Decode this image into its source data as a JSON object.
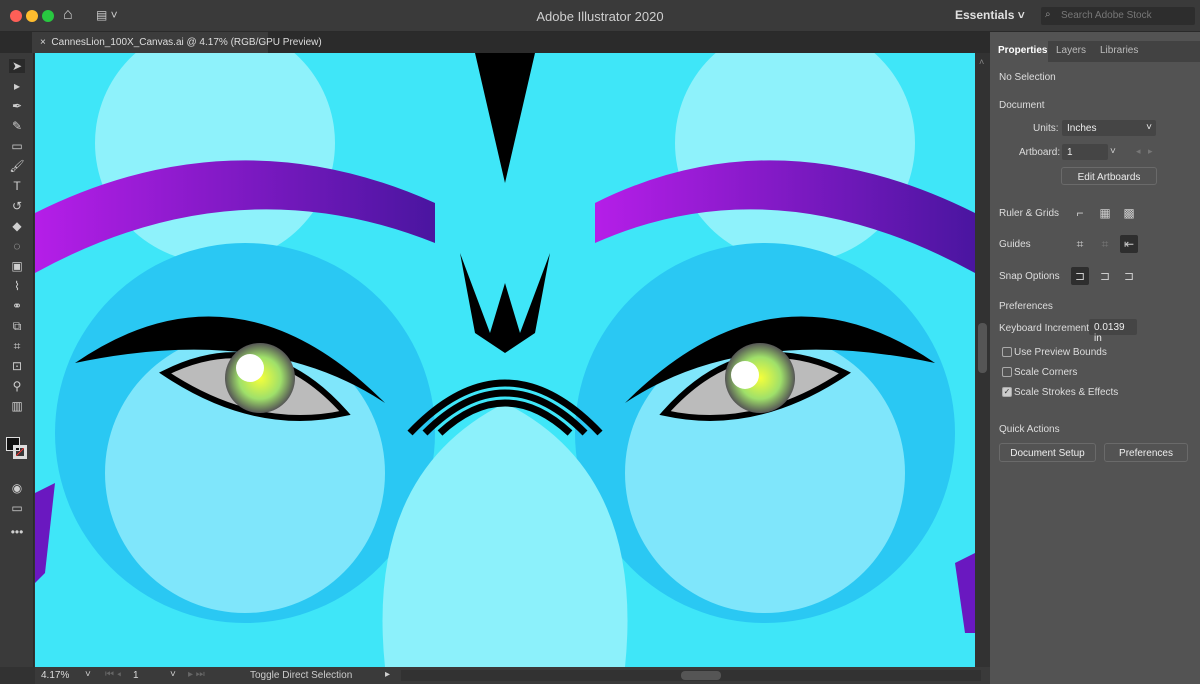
{
  "app": {
    "title": "Adobe Illustrator 2020",
    "workspace": "Essentials",
    "search_placeholder": "Search Adobe Stock"
  },
  "document_tab": {
    "close": "×",
    "label": "CannesLion_100X_Canvas.ai @ 4.17% (RGB/GPU Preview)"
  },
  "colors": {
    "artwork_cyan": "#39e4f7",
    "artwork_purple": "#8a1be0",
    "panel_bg": "#535353"
  },
  "panel": {
    "tabs": [
      "Properties",
      "Layers",
      "Libraries"
    ],
    "selection": "No Selection",
    "document_heading": "Document",
    "units_label": "Units:",
    "units_value": "Inches",
    "artboard_label": "Artboard:",
    "artboard_value": "1",
    "edit_artboards": "Edit Artboards",
    "ruler_grids": "Ruler & Grids",
    "guides": "Guides",
    "snap_options": "Snap Options",
    "preferences_heading": "Preferences",
    "keyboard_increment_label": "Keyboard Increment:",
    "keyboard_increment_value": "0.0139 in",
    "checkboxes": [
      {
        "label": "Use Preview Bounds",
        "checked": false
      },
      {
        "label": "Scale Corners",
        "checked": false
      },
      {
        "label": "Scale Strokes & Effects",
        "checked": true
      }
    ],
    "quick_actions": "Quick Actions",
    "document_setup": "Document Setup",
    "preferences_button": "Preferences"
  },
  "status": {
    "zoom": "4.17%",
    "artboard": "1",
    "tool_hint": "Toggle Direct Selection"
  }
}
